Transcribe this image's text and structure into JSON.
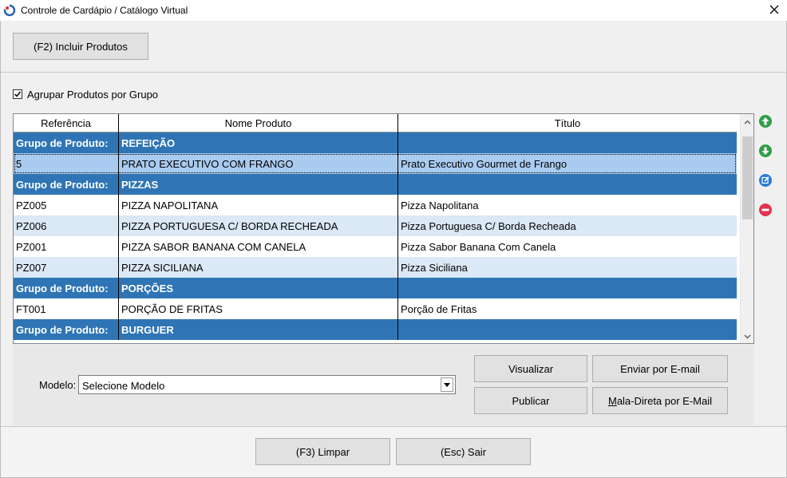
{
  "window": {
    "title": "Controle de Cardápio / Catálogo Virtual"
  },
  "toolbar": {
    "include_label": "(F2) Incluir Produtos"
  },
  "options": {
    "group_by_label": "Agrupar Produtos por Grupo",
    "group_by_checked": true
  },
  "grid": {
    "columns": [
      "Referência",
      "Nome Produto",
      "Título"
    ],
    "rows": [
      {
        "type": "group",
        "ref": "Grupo de Produto:",
        "name": "REFEIÇÃO",
        "title": ""
      },
      {
        "type": "item",
        "ref": "5",
        "name": "PRATO EXECUTIVO COM FRANGO",
        "title": "Prato Executivo Gourmet de Frango",
        "selected": true
      },
      {
        "type": "group",
        "ref": "Grupo de Produto:",
        "name": "PIZZAS",
        "title": ""
      },
      {
        "type": "item",
        "ref": "PZ005",
        "name": "PIZZA NAPOLITANA",
        "title": "Pizza Napolitana"
      },
      {
        "type": "item",
        "ref": "PZ006",
        "name": "PIZZA PORTUGUESA C/ BORDA RECHEADA",
        "title": "Pizza Portuguesa C/ Borda Recheada"
      },
      {
        "type": "item",
        "ref": "PZ001",
        "name": "PIZZA SABOR BANANA COM CANELA",
        "title": "Pizza Sabor Banana Com Canela"
      },
      {
        "type": "item",
        "ref": "PZ007",
        "name": "PIZZA SICILIANA",
        "title": "Pizza Siciliana"
      },
      {
        "type": "group",
        "ref": "Grupo de Produto:",
        "name": "PORÇÕES",
        "title": ""
      },
      {
        "type": "item",
        "ref": "FT001",
        "name": "PORÇÃO DE FRITAS",
        "title": "Porção de Fritas"
      },
      {
        "type": "group",
        "ref": "Grupo de Produto:",
        "name": "BURGUER",
        "title": ""
      }
    ]
  },
  "side_icons": [
    "arrow-up-icon",
    "arrow-down-icon",
    "edit-icon",
    "remove-icon"
  ],
  "model": {
    "label": "Modelo:",
    "selected": "Selecione Modelo"
  },
  "actions": {
    "visualize_label": "Visualizar",
    "email_label": "Enviar por E-mail",
    "publish_label": "Publicar",
    "mailing_first": "M",
    "mailing_rest": "ala-Direta por E-Mail"
  },
  "footer": {
    "clear_label": "(F3) Limpar",
    "exit_label": "(Esc) Sair"
  },
  "colors": {
    "group_row": "#2f75b5",
    "odd_row": "#dbe8f5",
    "selected_row": "#a9cbf0",
    "icon_green": "#2e9e48",
    "icon_blue": "#2b7bd6",
    "icon_red": "#e0334d"
  }
}
